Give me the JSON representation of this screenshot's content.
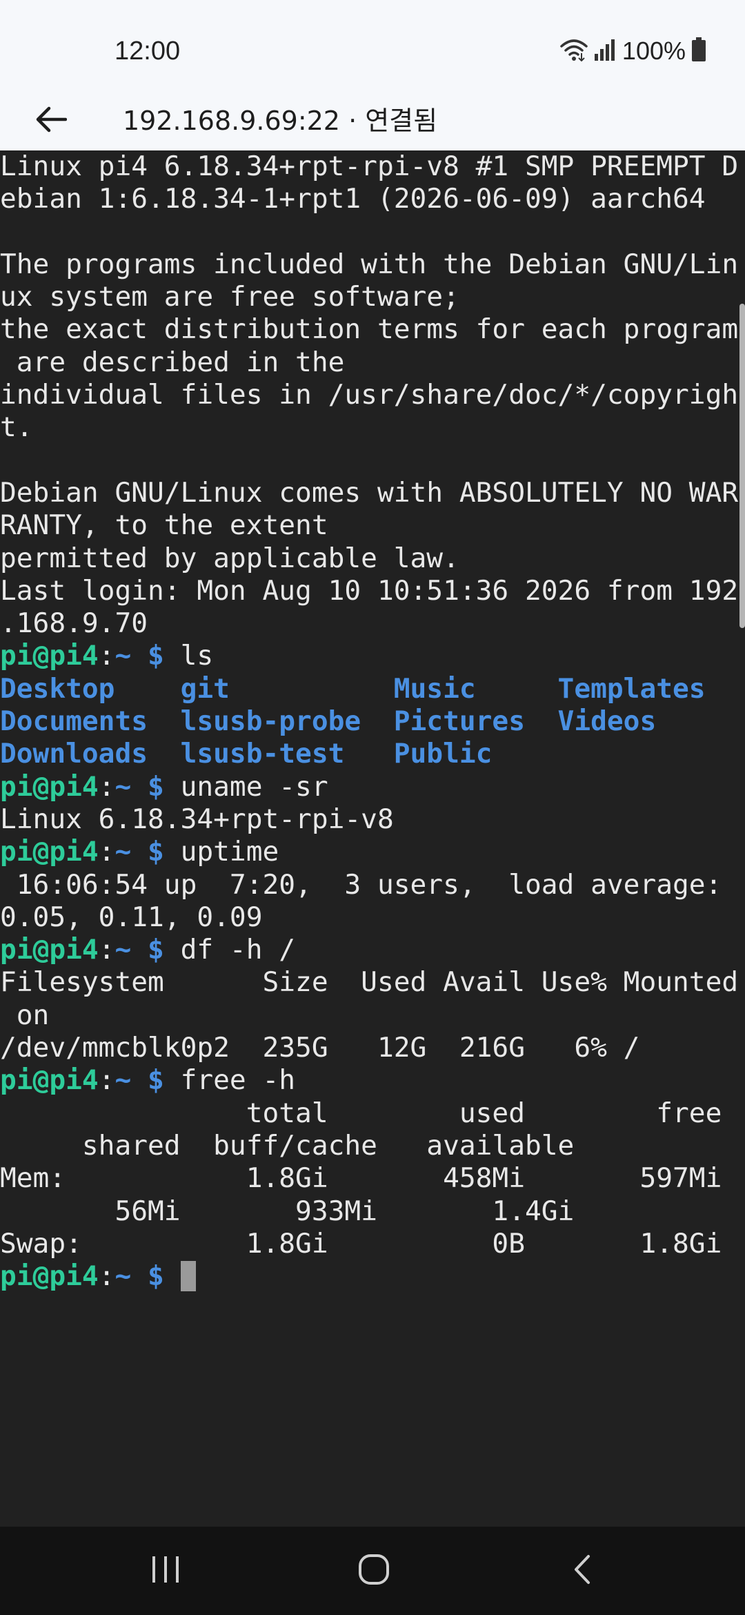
{
  "status_bar": {
    "time": "12:00",
    "battery": "100%",
    "icons": [
      "wifi-icon",
      "signal-icon",
      "battery-icon"
    ]
  },
  "app_bar": {
    "back_icon": "arrow-left-icon",
    "title": "192.168.9.69:22 · 연결됨"
  },
  "colors": {
    "terminal_bg": "#212121",
    "prompt_user": "#2ecc9a",
    "prompt_path": "#4a90e2",
    "directory": "#4a90e2",
    "text": "#e8e8e8"
  },
  "terminal": {
    "lines": [
      [
        {
          "t": "Linux pi4 6.18.34+rpt-rpi-v8 #1 SMP PREEMPT D",
          "c": "plain"
        }
      ],
      [
        {
          "t": "ebian 1:6.18.34-1+rpt1 (2026-06-09) aarch64",
          "c": "plain"
        }
      ],
      [
        {
          "t": "",
          "c": "plain"
        }
      ],
      [
        {
          "t": "The programs included with the Debian GNU/Lin",
          "c": "plain"
        }
      ],
      [
        {
          "t": "ux system are free software;",
          "c": "plain"
        }
      ],
      [
        {
          "t": "the exact distribution terms for each program",
          "c": "plain"
        }
      ],
      [
        {
          "t": " are described in the",
          "c": "plain"
        }
      ],
      [
        {
          "t": "individual files in /usr/share/doc/*/copyrigh",
          "c": "plain"
        }
      ],
      [
        {
          "t": "t.",
          "c": "plain"
        }
      ],
      [
        {
          "t": "",
          "c": "plain"
        }
      ],
      [
        {
          "t": "Debian GNU/Linux comes with ABSOLUTELY NO WAR",
          "c": "plain"
        }
      ],
      [
        {
          "t": "RANTY, to the extent",
          "c": "plain"
        }
      ],
      [
        {
          "t": "permitted by applicable law.",
          "c": "plain"
        }
      ],
      [
        {
          "t": "Last login: Mon Aug 10 10:51:36 2026 from 192",
          "c": "plain"
        }
      ],
      [
        {
          "t": ".168.9.70",
          "c": "plain"
        }
      ],
      [
        {
          "t": "pi@pi4",
          "c": "user"
        },
        {
          "t": ":",
          "c": "plain"
        },
        {
          "t": "~ $",
          "c": "path"
        },
        {
          "t": " ls",
          "c": "plain"
        }
      ],
      [
        {
          "t": "Desktop    git          Music     Templates",
          "c": "dir"
        }
      ],
      [
        {
          "t": "Documents  lsusb-probe  Pictures  Videos",
          "c": "dir"
        }
      ],
      [
        {
          "t": "Downloads  lsusb-test   Public",
          "c": "dir"
        }
      ],
      [
        {
          "t": "pi@pi4",
          "c": "user"
        },
        {
          "t": ":",
          "c": "plain"
        },
        {
          "t": "~ $",
          "c": "path"
        },
        {
          "t": " uname -sr",
          "c": "plain"
        }
      ],
      [
        {
          "t": "Linux 6.18.34+rpt-rpi-v8",
          "c": "plain"
        }
      ],
      [
        {
          "t": "pi@pi4",
          "c": "user"
        },
        {
          "t": ":",
          "c": "plain"
        },
        {
          "t": "~ $",
          "c": "path"
        },
        {
          "t": " uptime",
          "c": "plain"
        }
      ],
      [
        {
          "t": " 16:06:54 up  7:20,  3 users,  load average:",
          "c": "plain"
        }
      ],
      [
        {
          "t": "0.05, 0.11, 0.09",
          "c": "plain"
        }
      ],
      [
        {
          "t": "pi@pi4",
          "c": "user"
        },
        {
          "t": ":",
          "c": "plain"
        },
        {
          "t": "~ $",
          "c": "path"
        },
        {
          "t": " df -h /",
          "c": "plain"
        }
      ],
      [
        {
          "t": "Filesystem      Size  Used Avail Use% Mounted",
          "c": "plain"
        }
      ],
      [
        {
          "t": " on",
          "c": "plain"
        }
      ],
      [
        {
          "t": "/dev/mmcblk0p2  235G   12G  216G   6% /",
          "c": "plain"
        }
      ],
      [
        {
          "t": "pi@pi4",
          "c": "user"
        },
        {
          "t": ":",
          "c": "plain"
        },
        {
          "t": "~ $",
          "c": "path"
        },
        {
          "t": " free -h",
          "c": "plain"
        }
      ],
      [
        {
          "t": "               total        used        free",
          "c": "plain"
        }
      ],
      [
        {
          "t": "     shared  buff/cache   available",
          "c": "plain"
        }
      ],
      [
        {
          "t": "Mem:           1.8Gi       458Mi       597Mi",
          "c": "plain"
        }
      ],
      [
        {
          "t": "       56Mi       933Mi       1.4Gi",
          "c": "plain"
        }
      ],
      [
        {
          "t": "Swap:          1.8Gi          0B       1.8Gi",
          "c": "plain"
        }
      ],
      [
        {
          "t": "pi@pi4",
          "c": "user"
        },
        {
          "t": ":",
          "c": "plain"
        },
        {
          "t": "~ $",
          "c": "path"
        },
        {
          "t": " ",
          "c": "plain"
        },
        {
          "cursor": true
        }
      ]
    ]
  },
  "nav_bar": {
    "buttons": [
      "recent-apps-icon",
      "home-icon",
      "back-icon"
    ]
  }
}
